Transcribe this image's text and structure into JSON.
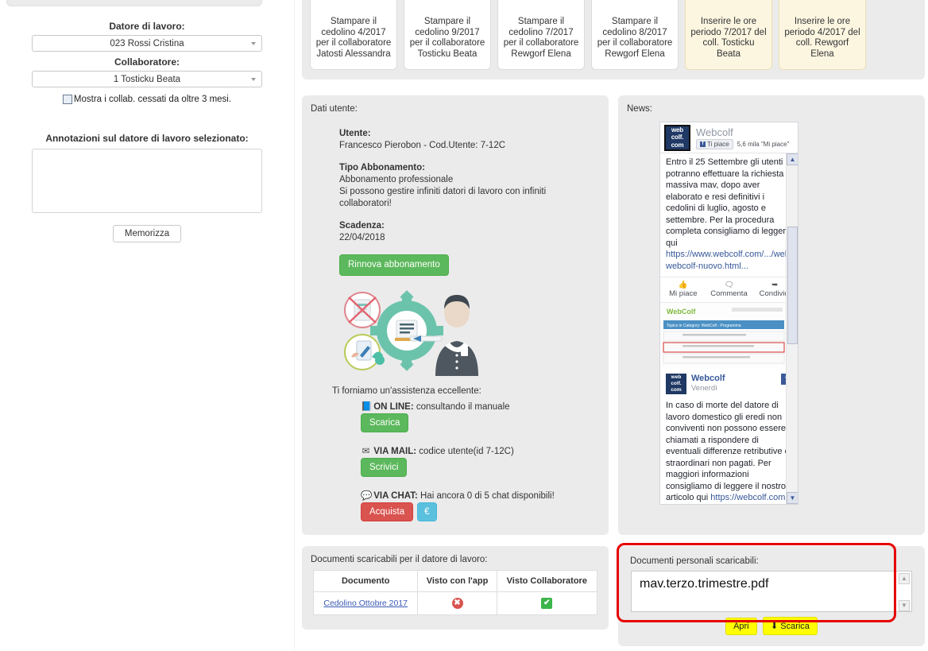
{
  "sidebar": {
    "employer_label": "Datore di lavoro:",
    "employer_value": "023 Rossi Cristina",
    "collaborator_label": "Collaboratore:",
    "collaborator_value": "1 Tosticku Beata",
    "show_ceased_label": "Mostra i collab. cessati da oltre 3 mesi.",
    "notes_label": "Annotazioni sul datore di lavoro selezionato:",
    "notes_value": "",
    "notes_placeholder": "",
    "save_button": "Memorizza"
  },
  "task_cards": [
    {
      "text": "Stampare il cedolino 4/2017 per il collaboratore Jatosti Alessandra",
      "type": "normal"
    },
    {
      "text": "Stampare il cedolino 9/2017 per il collaboratore Tosticku Beata",
      "type": "normal"
    },
    {
      "text": "Stampare il cedolino 7/2017 per il collaboratore Rewgorf Elena",
      "type": "normal"
    },
    {
      "text": "Stampare il cedolino 8/2017 per il collaboratore Rewgorf Elena",
      "type": "normal"
    },
    {
      "text": "Inserire le ore periodo 7/2017 del coll. Tosticku Beata",
      "type": "warning"
    },
    {
      "text": "Inserire le ore periodo 4/2017 del coll. Rewgorf Elena",
      "type": "warning"
    }
  ],
  "user_panel": {
    "panel_title": "Dati utente:",
    "user_label": "Utente:",
    "user_value": "Francesco Pierobon - Cod.Utente: 7-12C",
    "subscription_label": "Tipo Abbonamento:",
    "subscription_value": "Abbonamento professionale",
    "subscription_detail_1": "Si possono gestire infiniti datori di lavoro con infiniti",
    "subscription_detail_2": "collaboratori!",
    "expiry_label": "Scadenza:",
    "expiry_value": "22/04/2018",
    "renew_button": "Rinnova abbonamento"
  },
  "assistance": {
    "title": "Ti forniamo un'assistenza eccellente:",
    "online_label": "ON LINE:",
    "online_text": " consultando il manuale",
    "online_button": "Scarica",
    "mail_label": "VIA MAIL:",
    "mail_text": " codice utente(id 7-12C)",
    "mail_button": "Scrivici",
    "chat_label": "VIA CHAT:",
    "chat_text": " Hai ancora 0 di 5 chat disponibili!",
    "chat_button": "Acquista",
    "chat_info_icon": "€"
  },
  "news": {
    "panel_title": "News:",
    "page_name": "Webcolf",
    "logo_line1": "web",
    "logo_line2": "colf.",
    "logo_line3": "com",
    "like_button": "Ti piace",
    "like_count": "5,6 mila \"Mi piace\"",
    "post1_text": "Entro il 25 Settembre gli utenti potranno effettuare la richiesta massiva mav, dopo aver elaborato e resi definitivi i cedolini di luglio, agosto e settembre. Per la procedura completa consigliamo di leggere qui ",
    "post1_link": "https://www.webcolf.com/.../webco.../manuale-webcolf-nuovo.html...",
    "action_like": "Mi piace",
    "action_comment": "Commenta",
    "action_share": "Condividi",
    "post2_author": "Webcolf",
    "post2_date": "Venerdì",
    "post2_text": "In caso di morte del datore di lavoro domestico gli eredi non conviventi non possono essere chiamati a rispondere di eventuali differenze retributive o straordinari non pagati. Per maggiori informazioni consigliamo di leggere il nostro articolo qui ",
    "post2_link": "https://webcolf.com"
  },
  "documents_panel": {
    "title": "Documenti scaricabili per il datore di lavoro:",
    "columns": [
      "Documento",
      "Visto con l'app",
      "Visto Collaboratore"
    ],
    "rows": [
      {
        "document": "Cedolino Ottobre 2017",
        "app_seen": "no",
        "collab_seen": "yes"
      }
    ]
  },
  "personal_documents": {
    "title": "Documenti personali scaricabili:",
    "items": [
      "mav.terzo.trimestre.pdf"
    ],
    "open_button": "Apri",
    "download_button": "Scarica"
  },
  "colors": {
    "success_green": "#5cb85c",
    "danger_red": "#d9534f",
    "info_blue": "#5bc0de",
    "highlight_red": "#e60000",
    "yellow_button": "#ffff00",
    "panel_gray": "#ebebeb",
    "warning_card": "#fcf6e1"
  }
}
